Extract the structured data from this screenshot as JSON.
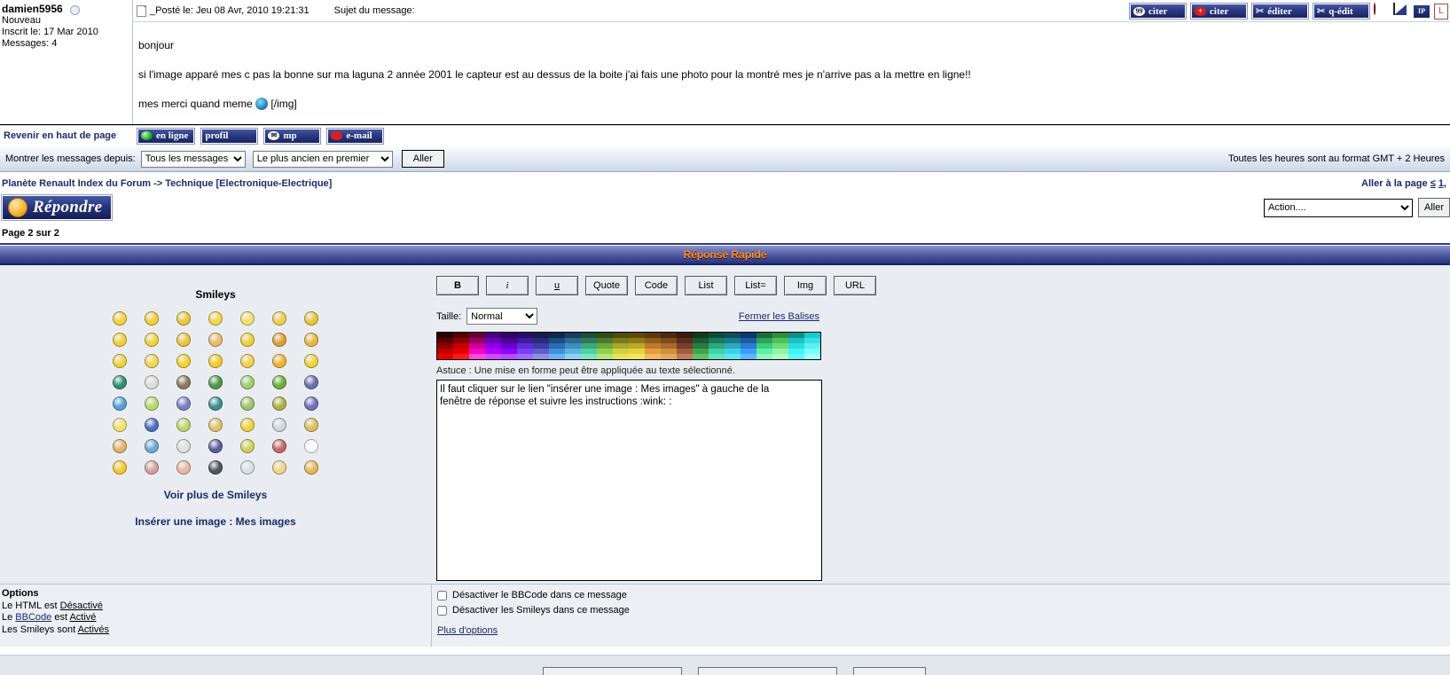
{
  "post": {
    "author": "damien5956",
    "rank": "Nouveau",
    "joined": "Inscrit le: 17 Mar 2010",
    "messages": "Messages: 4",
    "posted_label": "_Posté le: Jeu 08 Avr, 2010 19:21:31",
    "subject_label": "Sujet du message:",
    "body_line1": "bonjour",
    "body_line2": "si l'image apparé mes c pas la bonne sur ma laguna 2 année 2001 le capteur est au dessus de la boite j'ai fais une photo pour la montré mes je n'arrive pas a la mettre en ligne!!",
    "body_line3_pre": "mes merci quand meme",
    "body_line3_post": "[/img]",
    "back_to_top": "Revenir en haut de page",
    "toolbar": [
      {
        "label": "citer",
        "icon": "quote-bubble-icon"
      },
      {
        "label": "citer",
        "icon": "plus-bubble-icon"
      },
      {
        "label": "éditer",
        "icon": "scissors-icon"
      },
      {
        "label": "q-édit",
        "icon": "scissors-icon"
      }
    ],
    "toolbar_icons": [
      {
        "name": "delete-post-icon"
      },
      {
        "name": "note-icon"
      },
      {
        "name": "ip-icon",
        "label": "IP"
      },
      {
        "name": "report-icon",
        "label": "L"
      }
    ],
    "footer_buttons": [
      {
        "label": "en ligne",
        "icon": "green-ball-icon"
      },
      {
        "label": "profil",
        "icon": "profile-icon"
      },
      {
        "label": "mp",
        "icon": "envelope-icon"
      },
      {
        "label": "e-mail",
        "icon": "red-ball-icon"
      }
    ]
  },
  "filter": {
    "label": "Montrer les messages depuis:",
    "select_posts_value": "Tous les messages",
    "select_order_value": "Le plus ancien en premier",
    "go_label": "Aller",
    "gmt_note": "Toutes les heures sont au format GMT + 2 Heures"
  },
  "nav": {
    "breadcrumb": "Planète Renault Index du Forum -> Technique [Electronique-Electrique]",
    "goto_page_label": "Aller à la page",
    "goto_prev": "≤",
    "goto_page_1": "1,",
    "reply_button": "Répondre",
    "action_select_value": "Action....",
    "action_go": "Aller",
    "page_info": "Page 2 sur 2"
  },
  "quick_reply": {
    "title": "Réponse Rapide",
    "smileys_title": "Smileys",
    "more_smileys": "Voir plus de Smileys",
    "insert_image": "Insérer une image : Mes images",
    "bbcode_buttons": [
      "B",
      "i",
      "u",
      "Quote",
      "Code",
      "List",
      "List=",
      "Img",
      "URL"
    ],
    "taille_label": "Taille:",
    "taille_value": "Normal",
    "close_tags": "Fermer les Balises",
    "astuce": "Astuce : Une mise en forme peut être appliquée au texte sélectionné.",
    "message_text": "Il faut cliquer sur le lien \"insérer une image : Mes images\" à gauche de la\nfenêtre de réponse et suivre les instructions :wink: :"
  },
  "options": {
    "title": "Options",
    "html_line_pre": "Le HTML est ",
    "html_line_val": "Désactivé",
    "bbcode_pre": "Le ",
    "bbcode_link": "BBCode",
    "bbcode_mid": " est ",
    "bbcode_val": "Activé",
    "smileys_pre": "Les Smileys sont ",
    "smileys_val": "Activés",
    "check_bbcode": "Désactiver le BBCode dans ce message",
    "check_smileys": "Désactiver les Smileys dans ce message",
    "more_options": "Plus d'options"
  },
  "colors": {
    "accent_blue": "#1a2a6b",
    "title_orange": "#ff8a1e",
    "panel_bg": "#e9edf2"
  },
  "smileys": [
    [
      "#f2d23a",
      "#f0cf3a",
      "#edc63a",
      "#f3d64a",
      "#f6e06a",
      "#eed04a",
      "#e8c63a"
    ],
    [
      "#f0cf3a",
      "#f2d23a",
      "#edc43a",
      "#e8bb6a",
      "#f0cf3a",
      "#e0a030",
      "#e8b840"
    ],
    [
      "#f2d23a",
      "#f3d64a",
      "#f7d02a",
      "#f7c92a",
      "#f3cf4a",
      "#f0b52a",
      "#f2d23a"
    ],
    [
      "#2e8f6e",
      "#ddddd8",
      "#8c7a5c",
      "#4d9a3e",
      "#9fce6a",
      "#6fae3a",
      "#6a6fb0"
    ],
    [
      "#5a9fd4",
      "#b9d96a",
      "#7b7fc4",
      "#3e8f8f",
      "#9fc26a",
      "#b0b04a",
      "#6f72bb"
    ],
    [
      "#f6e06a",
      "#4f6fbf",
      "#c2d46a",
      "#e0c070",
      "#f2d23a",
      "#cfd8e0",
      "#d8c060"
    ],
    [
      "#e0b468",
      "#6fa8d8",
      "#dfe0d8",
      "#5d5f9c",
      "#cfd25a",
      "#c46a6a",
      "#ffffff"
    ],
    [
      "#f7c92a",
      "#d7a0a0",
      "#e8b8a0",
      "#4d5560",
      "#d8e0e8",
      "#f0d48a",
      "#e8b85a"
    ]
  ],
  "palette_rows": [
    [
      "#2b0000",
      "#550000",
      "#660033",
      "#4b0082",
      "#330066",
      "#2a0d6b",
      "#1a1a4d",
      "#0d2a4d",
      "#1a3d5c",
      "#1d4d3d",
      "#2d4d1a",
      "#4d4d0d",
      "#5c4a0d",
      "#5c3a0d",
      "#4d2a0d",
      "#3d1a0d",
      "#0d3d1a",
      "#0d4d3d",
      "#0d4d5c",
      "#0d3a6b",
      "#1a6b3d",
      "#2d8f3d",
      "#0d8f8f",
      "#0dcfcf"
    ],
    [
      "#5c0000",
      "#8f0000",
      "#990066",
      "#6b00b3",
      "#4d0099",
      "#3d1a9e",
      "#2a2a7a",
      "#1a4d80",
      "#2d6b8f",
      "#2d7a5c",
      "#4d7a2d",
      "#7a7a1a",
      "#8f7a1a",
      "#8f5c1a",
      "#7a4d1a",
      "#5c2d1a",
      "#1a5c2d",
      "#1a7a5c",
      "#1a7a8f",
      "#1a5c9e",
      "#2da35c",
      "#4dc25c",
      "#1ac2c2",
      "#3de0e0"
    ],
    [
      "#8f0000",
      "#c20000",
      "#cc0099",
      "#8f00e6",
      "#6b00cc",
      "#5c2dd1",
      "#3d3da3",
      "#2d6bb3",
      "#3d8fbd",
      "#3da87a",
      "#6ba83d",
      "#a8a82d",
      "#bda82d",
      "#bd7a2d",
      "#a86b2d",
      "#7a3d2d",
      "#2d7a3d",
      "#2da87a",
      "#2da8bd",
      "#2d7ad1",
      "#3dcc7a",
      "#6bdb7a",
      "#2ddbdb",
      "#5cf0f0"
    ],
    [
      "#c20000",
      "#e60000",
      "#ff00cc",
      "#b300ff",
      "#8f00ff",
      "#7a3dff",
      "#5c5ccc",
      "#3d8fe0",
      "#5cb3e0",
      "#4dd1a3",
      "#8fd14d",
      "#d1d13d",
      "#e6d13d",
      "#e69c3d",
      "#d18f3d",
      "#a35c3d",
      "#3da34d",
      "#3dd1a3",
      "#3dd1e6",
      "#3d9cff",
      "#5cf0a3",
      "#8ff5a3",
      "#3df5f5",
      "#7affff"
    ],
    [
      "#e60000",
      "#ff1a1a",
      "#ff4ddb",
      "#cc4dff",
      "#b34dff",
      "#9c6bff",
      "#8f8fe0",
      "#6bb3f0",
      "#8fcfef",
      "#7ae6c2",
      "#b3e67a",
      "#e6e65c",
      "#f5e65c",
      "#f5b85c",
      "#e6a85c",
      "#c27a5c",
      "#5cc26b",
      "#5ce6c2",
      "#5ce6f5",
      "#5cb8ff",
      "#8ff5c2",
      "#b3fac2",
      "#5cfafa",
      "#a3ffff"
    ]
  ]
}
